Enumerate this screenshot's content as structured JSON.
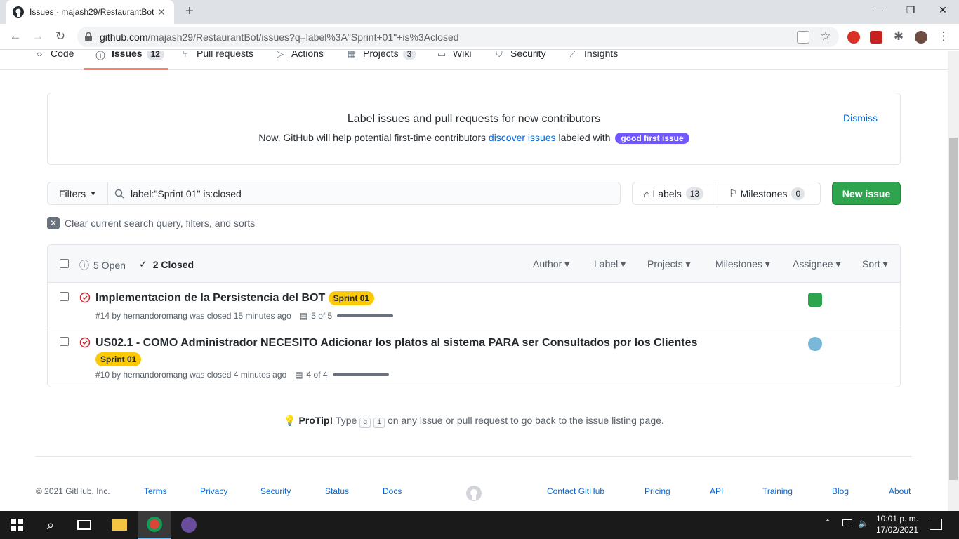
{
  "browser": {
    "tab_title": "Issues · majash29/RestaurantBot",
    "url_domain": "github.com",
    "url_path": "/majash29/RestaurantBot/issues?q=label%3A\"Sprint+01\"+is%3Aclosed"
  },
  "repo_nav": {
    "tabs": [
      {
        "label": "Code",
        "icon": "code-icon"
      },
      {
        "label": "Issues",
        "icon": "issue-opened-icon",
        "count": "12"
      },
      {
        "label": "Pull requests",
        "icon": "git-pull-request-icon"
      },
      {
        "label": "Actions",
        "icon": "play-icon"
      },
      {
        "label": "Projects",
        "icon": "project-icon",
        "count": "3"
      },
      {
        "label": "Wiki",
        "icon": "book-icon"
      },
      {
        "label": "Security",
        "icon": "shield-icon"
      },
      {
        "label": "Insights",
        "icon": "graph-icon"
      }
    ]
  },
  "banner": {
    "title": "Label issues and pull requests for new contributors",
    "text_before": "Now, GitHub will help potential first-time contributors",
    "link": "discover issues",
    "text_after": "labeled with",
    "label": "good first issue",
    "dismiss": "Dismiss"
  },
  "filters": {
    "filters_label": "Filters",
    "search_value": "label:\"Sprint 01\" is:closed",
    "labels_label": "Labels",
    "labels_count": "13",
    "milestones_label": "Milestones",
    "milestones_count": "0",
    "new_issue": "New issue",
    "clear": "Clear current search query, filters, and sorts"
  },
  "list_header": {
    "open": "5 Open",
    "closed": "2 Closed",
    "sorts": [
      "Author",
      "Label",
      "Projects",
      "Milestones",
      "Assignee",
      "Sort"
    ]
  },
  "issues": [
    {
      "title": "Implementacion de la Persistencia del BOT",
      "label": "Sprint 01",
      "meta": "#14 by hernandoromang was closed 15 minutes ago",
      "tasks": "5 of 5",
      "progress": 1.0
    },
    {
      "title": "US02.1 - COMO Administrador NECESITO Adicionar los platos al sistema PARA ser Consultados por los Clientes",
      "label": "Sprint 01",
      "meta": "#10 by hernandoromang was closed 4 minutes ago",
      "tasks": "4 of 4",
      "progress": 1.0
    }
  ],
  "protip": {
    "bold": "ProTip!",
    "text_a": "Type",
    "key1": "g",
    "key2": "i",
    "text_b": "on any issue or pull request to go back to the issue listing page."
  },
  "footer": {
    "copyright": "© 2021 GitHub, Inc.",
    "links_left": [
      "Terms",
      "Privacy",
      "Security",
      "Status",
      "Docs"
    ],
    "links_right": [
      "Contact GitHub",
      "Pricing",
      "API",
      "Training",
      "Blog",
      "About"
    ]
  },
  "taskbar": {
    "time": "10:01 p. m.",
    "date": "17/02/2021"
  },
  "colors": {
    "accent": "#f9826c",
    "green": "#2ea44f",
    "label_yellow": "#fbca04",
    "gfi_purple": "#7057ff",
    "closed_red": "#cb2431"
  }
}
